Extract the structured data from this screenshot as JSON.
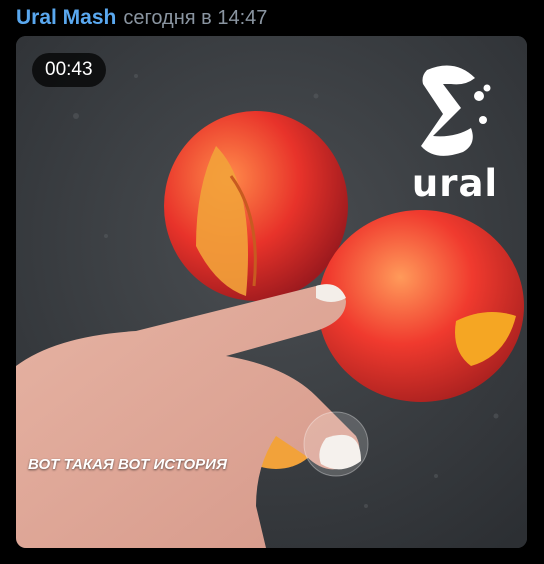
{
  "message": {
    "author": "Ural Mash",
    "timestamp": "сегодня в 14:47"
  },
  "video": {
    "duration": "00:43",
    "brand": "ural",
    "caption": "ВОТ ТАКАЯ ВОТ ИСТОРИЯ"
  },
  "colors": {
    "author": "#5aa8ef",
    "timestamp": "#8a95a1",
    "background": "#000000",
    "badge_bg": "#000000b8"
  }
}
